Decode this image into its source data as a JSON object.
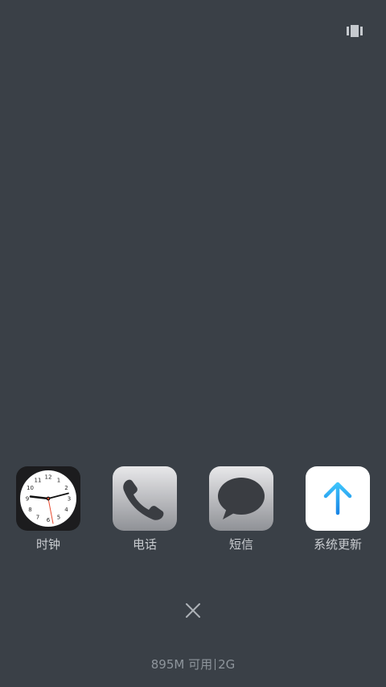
{
  "recent_apps": [
    {
      "label": "时钟",
      "icon": "clock-icon"
    },
    {
      "label": "电话",
      "icon": "phone-icon"
    },
    {
      "label": "短信",
      "icon": "messages-icon"
    },
    {
      "label": "系统更新",
      "icon": "system-update-icon",
      "accent": "#1fa3f0"
    }
  ],
  "clock": {
    "numerals": [
      "12",
      "1",
      "2",
      "3",
      "4",
      "5",
      "6",
      "7",
      "8",
      "9",
      "10",
      "11"
    ]
  },
  "status": {
    "memory": "895M 可用",
    "total": "2G"
  },
  "colors": {
    "background": "#3a4047",
    "label": "#c9ccd0",
    "status": "#8e959c"
  }
}
